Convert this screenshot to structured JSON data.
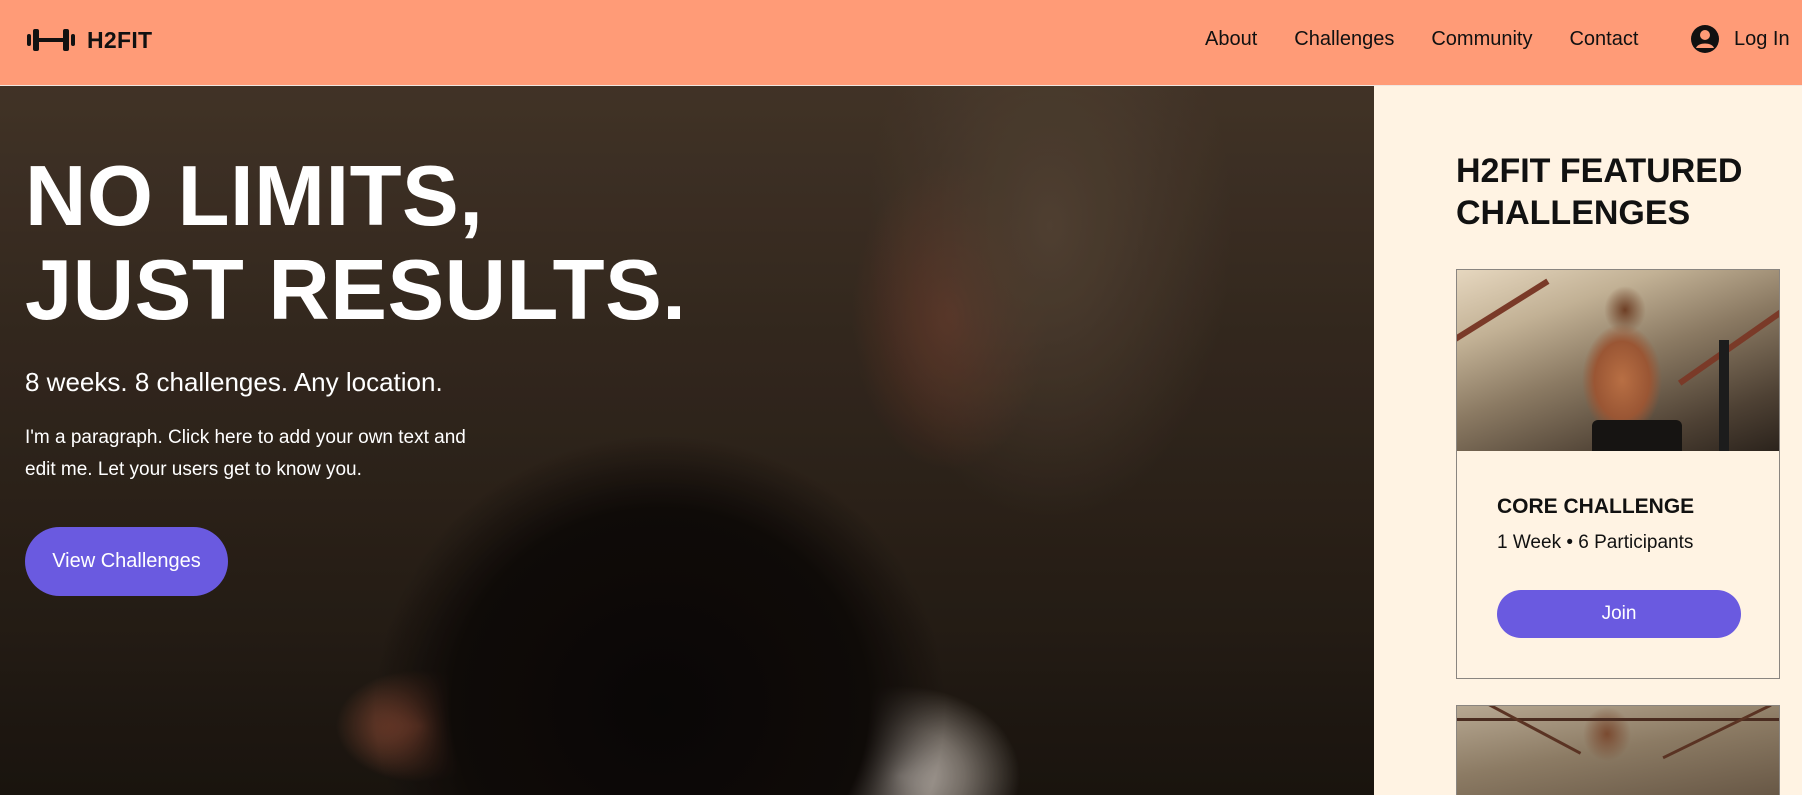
{
  "brand": {
    "name": "H2FIT",
    "logo_icon": "dumbbell-icon",
    "header_color": "#ff9b77",
    "accent": "#6a5ae0"
  },
  "nav": {
    "items": [
      "About",
      "Challenges",
      "Community",
      "Contact"
    ]
  },
  "login": {
    "label": "Log In",
    "icon": "user-avatar-icon"
  },
  "hero": {
    "title_line1": "NO LIMITS,",
    "title_line2": "JUST RESULTS.",
    "subtitle": "8 weeks. 8 challenges. Any location.",
    "paragraph": "I'm a paragraph. Click here to add your own text and edit me. Let your users get to know you.",
    "button_label": "View Challenges"
  },
  "sidebar": {
    "title": "H2FIT FEATURED CHALLENGES",
    "cards": [
      {
        "name": "CORE CHALLENGE",
        "meta": "1 Week • 6 Participants",
        "button_label": "Join"
      }
    ]
  }
}
